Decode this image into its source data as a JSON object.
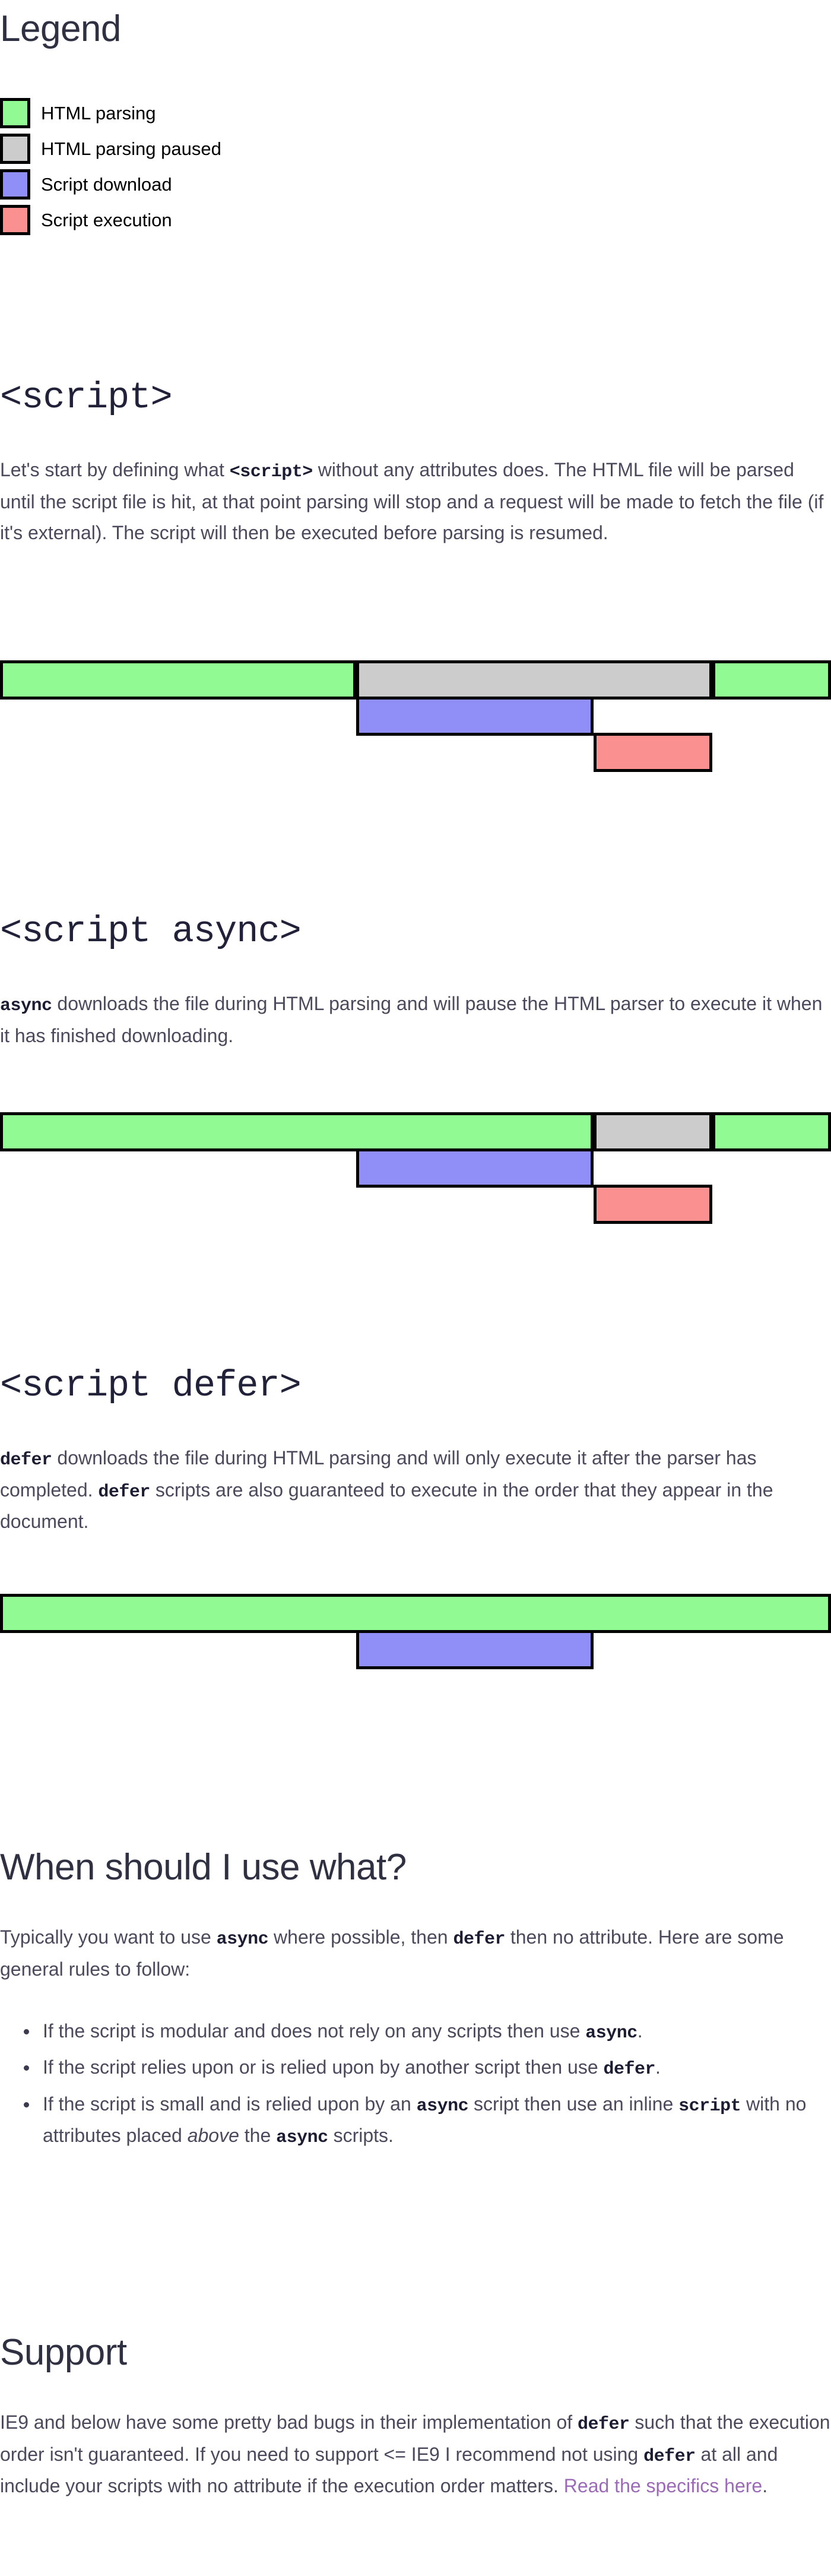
{
  "legend": {
    "title": "Legend",
    "items": [
      {
        "label": "HTML parsing",
        "color": "#92fa92",
        "key": "html-parsing"
      },
      {
        "label": "HTML parsing paused",
        "color": "#cccccc",
        "key": "html-parsing-paused"
      },
      {
        "label": "Script download",
        "color": "#8f8ff7",
        "key": "script-download"
      },
      {
        "label": "Script execution",
        "color": "#fa9090",
        "key": "script-execution"
      }
    ]
  },
  "sections": {
    "script": {
      "heading": "<script>",
      "paragraph_1": "Let's start by defining what ",
      "paragraph_code": "<script>",
      "paragraph_2": " without any attributes does. The HTML file will be parsed until the script file is hit, at that point parsing will stop and a request will be made to fetch the file (if it's external). The script will then be executed before parsing is resumed."
    },
    "script_async": {
      "heading": "<script async>",
      "paragraph_code": "async",
      "paragraph_rest": " downloads the file during HTML parsing and will pause the HTML parser to execute it when it has finished downloading."
    },
    "script_defer": {
      "heading": "<script defer>",
      "paragraph_code_1": "defer",
      "paragraph_part_1": " downloads the file during HTML parsing and will only execute it after the parser has completed. ",
      "paragraph_code_2": "defer",
      "paragraph_part_2": " scripts are also guaranteed to execute in the order that they appear in the document."
    },
    "when_to_use": {
      "heading": "When should I use what?",
      "intro_1": "Typically you want to use ",
      "intro_code_1": "async",
      "intro_2": " where possible, then ",
      "intro_code_2": "defer",
      "intro_3": " then no attribute. Here are some general rules to follow:",
      "rules": [
        {
          "part_1": "If the script is modular and does not rely on any scripts then use ",
          "code_1": "async",
          "part_2": "."
        },
        {
          "part_1": "If the script relies upon or is relied upon by another script then use ",
          "code_1": "defer",
          "part_2": "."
        },
        {
          "part_1": "If the script is small and is relied upon by an ",
          "code_1": "async",
          "part_2": " script then use an inline ",
          "code_2": "script",
          "part_3": " with no attributes placed ",
          "emphasis": "above",
          "part_4": " the ",
          "code_3": "async",
          "part_5": " scripts."
        }
      ]
    },
    "support": {
      "heading": "Support",
      "part_1": "IE9 and below have some pretty bad bugs in their implementation of ",
      "code_1": "defer",
      "part_2": " such that the execution order isn't guaranteed. If you need to support <= IE9 I recommend not using ",
      "code_2": "defer",
      "part_3": " at all and include your scripts with no attribute if the execution order matters. ",
      "link_text": "Read the specifics here",
      "part_4": "."
    }
  },
  "chart_data": [
    {
      "type": "timeline",
      "name": "script-timeline",
      "title": "<script>",
      "x_range": [
        0,
        1400
      ],
      "rows": [
        {
          "row": "html-parser",
          "segments": [
            {
              "kind": "HTML parsing",
              "color": "#92fa92",
              "start": 0,
              "end": 600
            },
            {
              "kind": "HTML parsing paused",
              "color": "#cccccc",
              "start": 600,
              "end": 1200
            },
            {
              "kind": "HTML parsing",
              "color": "#92fa92",
              "start": 1200,
              "end": 1400
            }
          ]
        },
        {
          "row": "script-download",
          "segments": [
            {
              "kind": "Script download",
              "color": "#8f8ff7",
              "start": 600,
              "end": 1000
            }
          ]
        },
        {
          "row": "script-execution",
          "segments": [
            {
              "kind": "Script execution",
              "color": "#fa9090",
              "start": 1000,
              "end": 1200
            }
          ]
        }
      ]
    },
    {
      "type": "timeline",
      "name": "script-async-timeline",
      "title": "<script async>",
      "x_range": [
        0,
        1400
      ],
      "rows": [
        {
          "row": "html-parser",
          "segments": [
            {
              "kind": "HTML parsing",
              "color": "#92fa92",
              "start": 0,
              "end": 1000
            },
            {
              "kind": "HTML parsing paused",
              "color": "#cccccc",
              "start": 1000,
              "end": 1200
            },
            {
              "kind": "HTML parsing",
              "color": "#92fa92",
              "start": 1200,
              "end": 1400
            }
          ]
        },
        {
          "row": "script-download",
          "segments": [
            {
              "kind": "Script download",
              "color": "#8f8ff7",
              "start": 600,
              "end": 1000
            }
          ]
        },
        {
          "row": "script-execution",
          "segments": [
            {
              "kind": "Script execution",
              "color": "#fa9090",
              "start": 1000,
              "end": 1200
            }
          ]
        }
      ]
    },
    {
      "type": "timeline",
      "name": "script-defer-timeline",
      "title": "<script defer>",
      "x_range": [
        0,
        1400
      ],
      "rows": [
        {
          "row": "html-parser",
          "segments": [
            {
              "kind": "HTML parsing",
              "color": "#92fa92",
              "start": 0,
              "end": 1400
            }
          ]
        },
        {
          "row": "script-download",
          "segments": [
            {
              "kind": "Script download",
              "color": "#8f8ff7",
              "start": 600,
              "end": 1000
            }
          ]
        }
      ]
    }
  ]
}
